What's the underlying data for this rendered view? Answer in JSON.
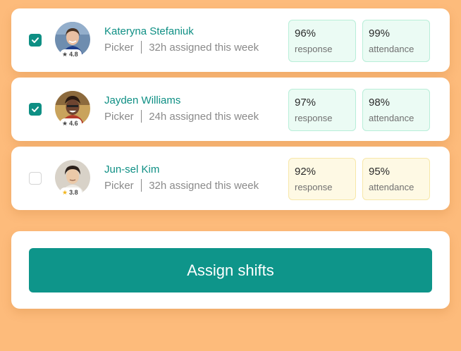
{
  "workers": [
    {
      "name": "Kateryna Stefaniuk",
      "role": "Picker",
      "hours": "32h assigned this week",
      "rating": "4.8",
      "selected": true,
      "metrics": [
        {
          "value": "96%",
          "label": "response"
        },
        {
          "value": "99%",
          "label": "attendance"
        }
      ]
    },
    {
      "name": "Jayden Williams",
      "role": "Picker",
      "hours": "24h assigned this week",
      "rating": "4.6",
      "selected": true,
      "metrics": [
        {
          "value": "97%",
          "label": "response"
        },
        {
          "value": "98%",
          "label": "attendance"
        }
      ]
    },
    {
      "name": "Jun-sel Kim",
      "role": "Picker",
      "hours": "32h assigned this week",
      "rating": "3.8",
      "selected": false,
      "metrics": [
        {
          "value": "92%",
          "label": "response"
        },
        {
          "value": "95%",
          "label": "attendance"
        }
      ]
    }
  ],
  "assign_button": {
    "label": "Assign shifts"
  },
  "colors": {
    "background": "#FDBB7B",
    "accent": "#0E8F84",
    "metric_good_bg": "#EBFBF4",
    "metric_warn_bg": "#FEF9E4"
  }
}
